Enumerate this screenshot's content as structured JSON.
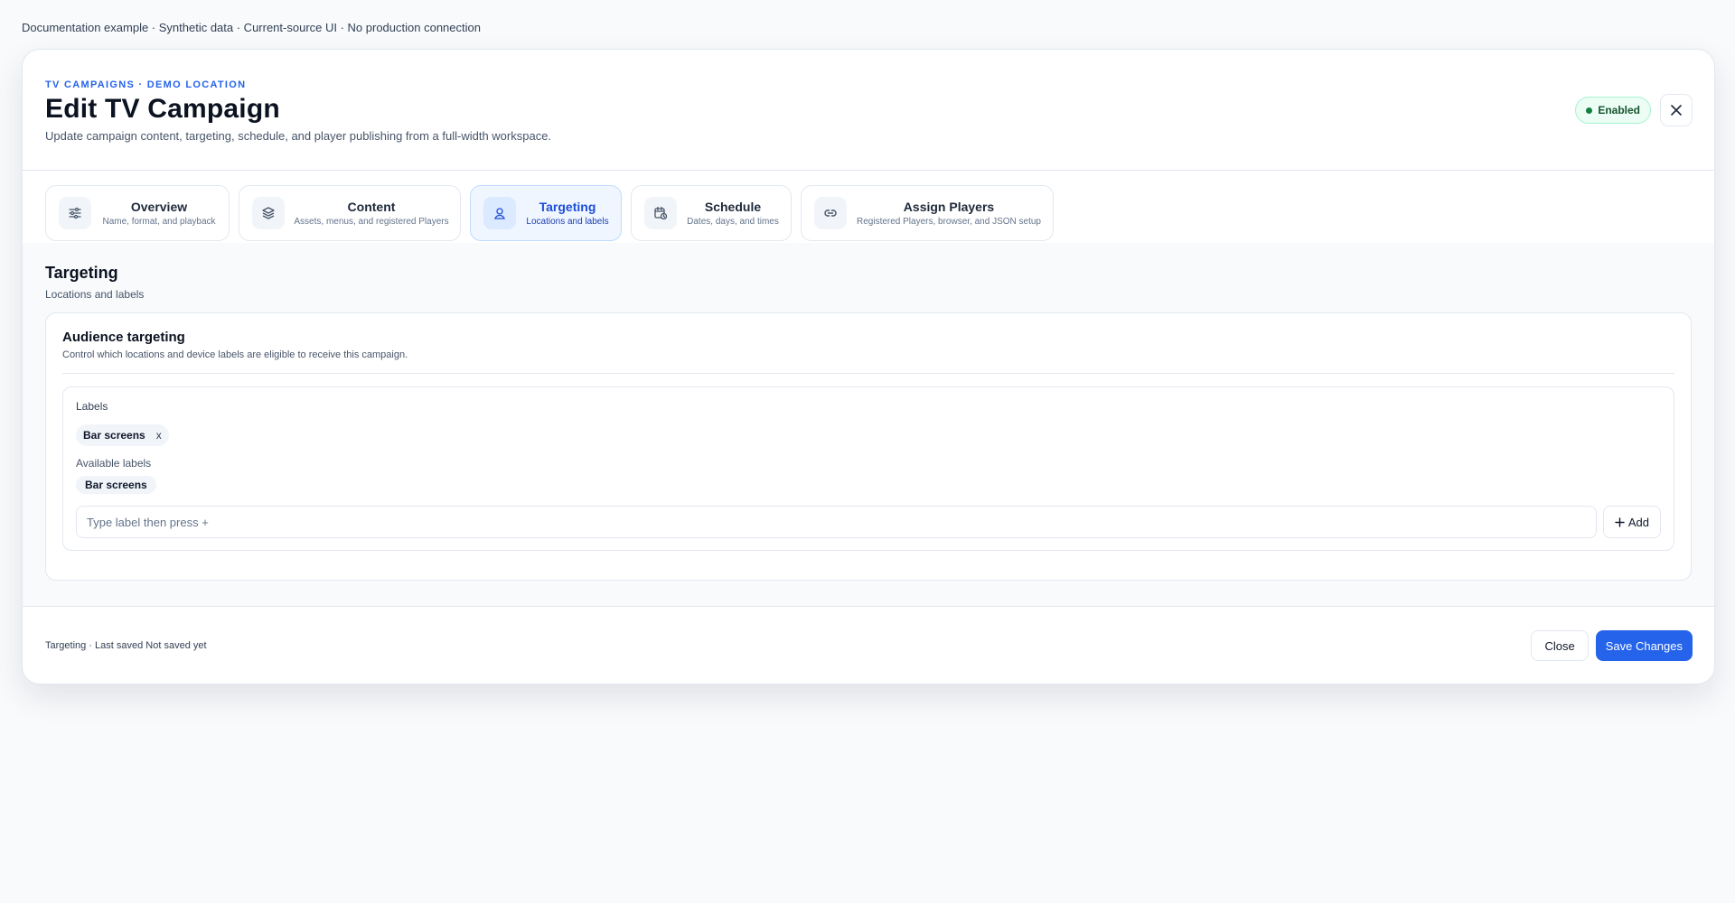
{
  "top_note": "Documentation example · Synthetic data · Current-source UI · No production connection",
  "header": {
    "eyebrow": "TV CAMPAIGNS · DEMO LOCATION",
    "title": "Edit TV Campaign",
    "subtitle": "Update campaign content, targeting, schedule, and player publishing from a full-width workspace.",
    "status_badge": "Enabled",
    "close_icon": "close-icon"
  },
  "tabs": [
    {
      "label": "Overview",
      "desc": "Name, format, and playback",
      "icon": "sliders-icon",
      "active": false
    },
    {
      "label": "Content",
      "desc": "Assets, menus, and registered Players",
      "icon": "layers-icon",
      "active": false
    },
    {
      "label": "Targeting",
      "desc": "Locations and labels",
      "icon": "location-pin-icon",
      "active": true
    },
    {
      "label": "Schedule",
      "desc": "Dates, days, and times",
      "icon": "calendar-clock-icon",
      "active": false
    },
    {
      "label": "Assign Players",
      "desc": "Registered Players, browser, and JSON setup",
      "icon": "link-icon",
      "active": false
    }
  ],
  "section": {
    "title": "Targeting",
    "subtitle": "Locations and labels"
  },
  "card": {
    "title": "Audience targeting",
    "subtitle": "Control which locations and device labels are eligible to receive this campaign.",
    "labels_heading": "Labels",
    "selected_labels": [
      {
        "text": "Bar screens",
        "remove": "x"
      }
    ],
    "available_heading": "Available labels",
    "available_labels": [
      "Bar screens"
    ],
    "input_placeholder": "Type label then press +",
    "input_value": "",
    "add_label": "Add"
  },
  "footer": {
    "status": "Targeting · Last saved Not saved yet",
    "close_label": "Close",
    "save_label": "Save Changes"
  },
  "colors": {
    "accent": "#2563eb",
    "enabled_bg": "#ecfdf5",
    "enabled_text": "#14532d"
  }
}
